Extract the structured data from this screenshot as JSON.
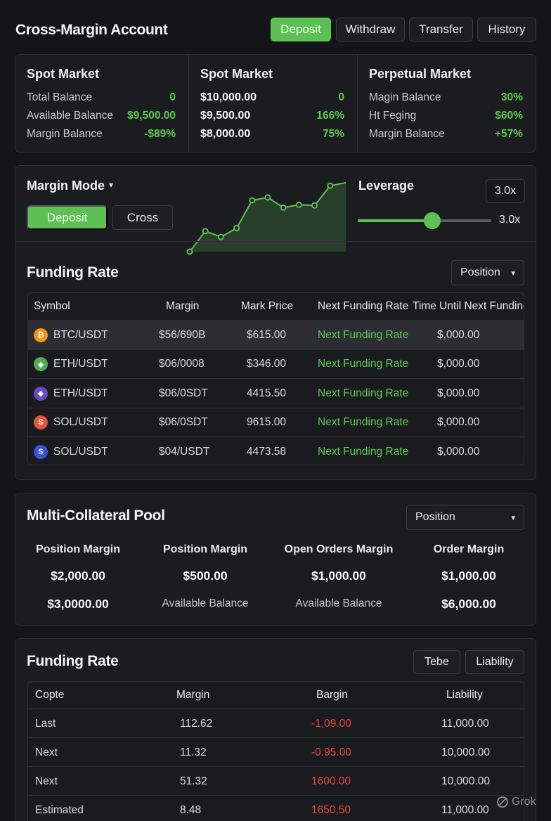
{
  "header": {
    "title": "Cross-Margin Account",
    "buttons": {
      "deposit": "Deposit",
      "withdraw": "Withdraw",
      "transfer": "Transfer",
      "history": "History"
    }
  },
  "overview": {
    "col1": {
      "title": "Spot Market",
      "rows": [
        {
          "label": "Total Balance",
          "value": "0"
        },
        {
          "label": "Available Balance",
          "value": "$9,500.00"
        },
        {
          "label": "Margin Balance",
          "value": "-$89%"
        }
      ]
    },
    "col2": {
      "title": "Spot Market",
      "rows": [
        {
          "label": "$10,000.00",
          "value": "0"
        },
        {
          "label": "$9,500.00",
          "value": "166%"
        },
        {
          "label": "$8,000.00",
          "value": "75%"
        }
      ]
    },
    "col3": {
      "title": "Perpetual Market",
      "rows": [
        {
          "label": "Magin Balance",
          "value": "30%"
        },
        {
          "label": "Ht Feging",
          "value": "$60%"
        },
        {
          "label": "Margin Balance",
          "value": "+57%"
        }
      ]
    }
  },
  "margin": {
    "mode_label": "Margin Mode",
    "btn_active": "Deposit",
    "btn_inactive": "Cross",
    "sparkline": [
      8,
      36,
      28,
      40,
      78,
      82,
      68,
      72,
      71,
      98,
      102
    ],
    "leverage_label": "Leverage",
    "leverage_box": "3.0x",
    "leverage_value": "3.0x",
    "leverage_fraction": 0.56
  },
  "funding": {
    "title": "Funding Rate",
    "dropdown": "Position",
    "headers": [
      "Symbol",
      "Margin",
      "Mark Price",
      "Next Funding Rate",
      "Time Until Next Funding"
    ],
    "rows": [
      {
        "icon": "bitcoin-icon",
        "color": "#f7931a",
        "glyph": "₿",
        "symbol": "BTC/USDT",
        "margin": "$56/690B",
        "price": "$615.00",
        "rate": "Next Funding Rate",
        "time": "$,000.00"
      },
      {
        "icon": "ethereum-icon",
        "color": "#4caf50",
        "glyph": "◆",
        "symbol": "ETH/USDT",
        "margin": "$06/0008",
        "price": "$346.00",
        "rate": "Next Funding Rate",
        "time": "$,000.00"
      },
      {
        "icon": "ethereum-icon",
        "color": "#6a4bc4",
        "glyph": "◆",
        "symbol": "ETH/USDT",
        "margin": "$06/0SDT",
        "price": "4415.50",
        "rate": "Next Funding Rate",
        "time": "$,000.00"
      },
      {
        "icon": "solana-icon",
        "color": "#e2553a",
        "glyph": "S",
        "symbol": "SOL/USDT",
        "margin": "$06/0SDT",
        "price": "9615.00",
        "rate": "Next Funding Rate",
        "time": "$,000.00"
      },
      {
        "icon": "solana-icon",
        "color": "#3853d6",
        "glyph": "S",
        "symbol": "SOL/USDT",
        "margin": "$04/USDT",
        "price": "4473.58",
        "rate": "Next Funding Rate",
        "time": "$,000.00"
      }
    ]
  },
  "pool": {
    "title": "Multi-Collateral Pool",
    "dropdown": "Position",
    "columns": [
      {
        "label": "Position Margin",
        "value": "$2,000.00",
        "sub": "$3,0000.00",
        "sub_bold": true
      },
      {
        "label": "Position Margin",
        "value": "$500.00",
        "sub": "Available Balance",
        "sub_bold": false
      },
      {
        "label": "Open Orders Margin",
        "value": "$1,000.00",
        "sub": "Available Balance",
        "sub_bold": false
      },
      {
        "label": "Order Margin",
        "value": "$1,000.00",
        "sub": "$6,000.00",
        "sub_bold": true
      }
    ]
  },
  "funding2": {
    "title": "Funding Rate",
    "btn1": "Tebe",
    "btn2": "Liability",
    "headers": [
      "Copte",
      "Margin",
      "Bargin",
      "Liability"
    ],
    "rows": [
      {
        "c1": "Last",
        "c2": "112.62",
        "c3": "-1,09.00",
        "c4": "11,000.00"
      },
      {
        "c1": "Next",
        "c2": "11.32",
        "c3": "-0.95.00",
        "c4": "10,000.00"
      },
      {
        "c1": "Next",
        "c2": "51.32",
        "c3": "1600.00",
        "c4": "10,000.00"
      },
      {
        "c1": "Estimated",
        "c2": "8.48",
        "c3": "1650.50",
        "c4": "11,000.00"
      }
    ]
  },
  "watermark": "Grok"
}
